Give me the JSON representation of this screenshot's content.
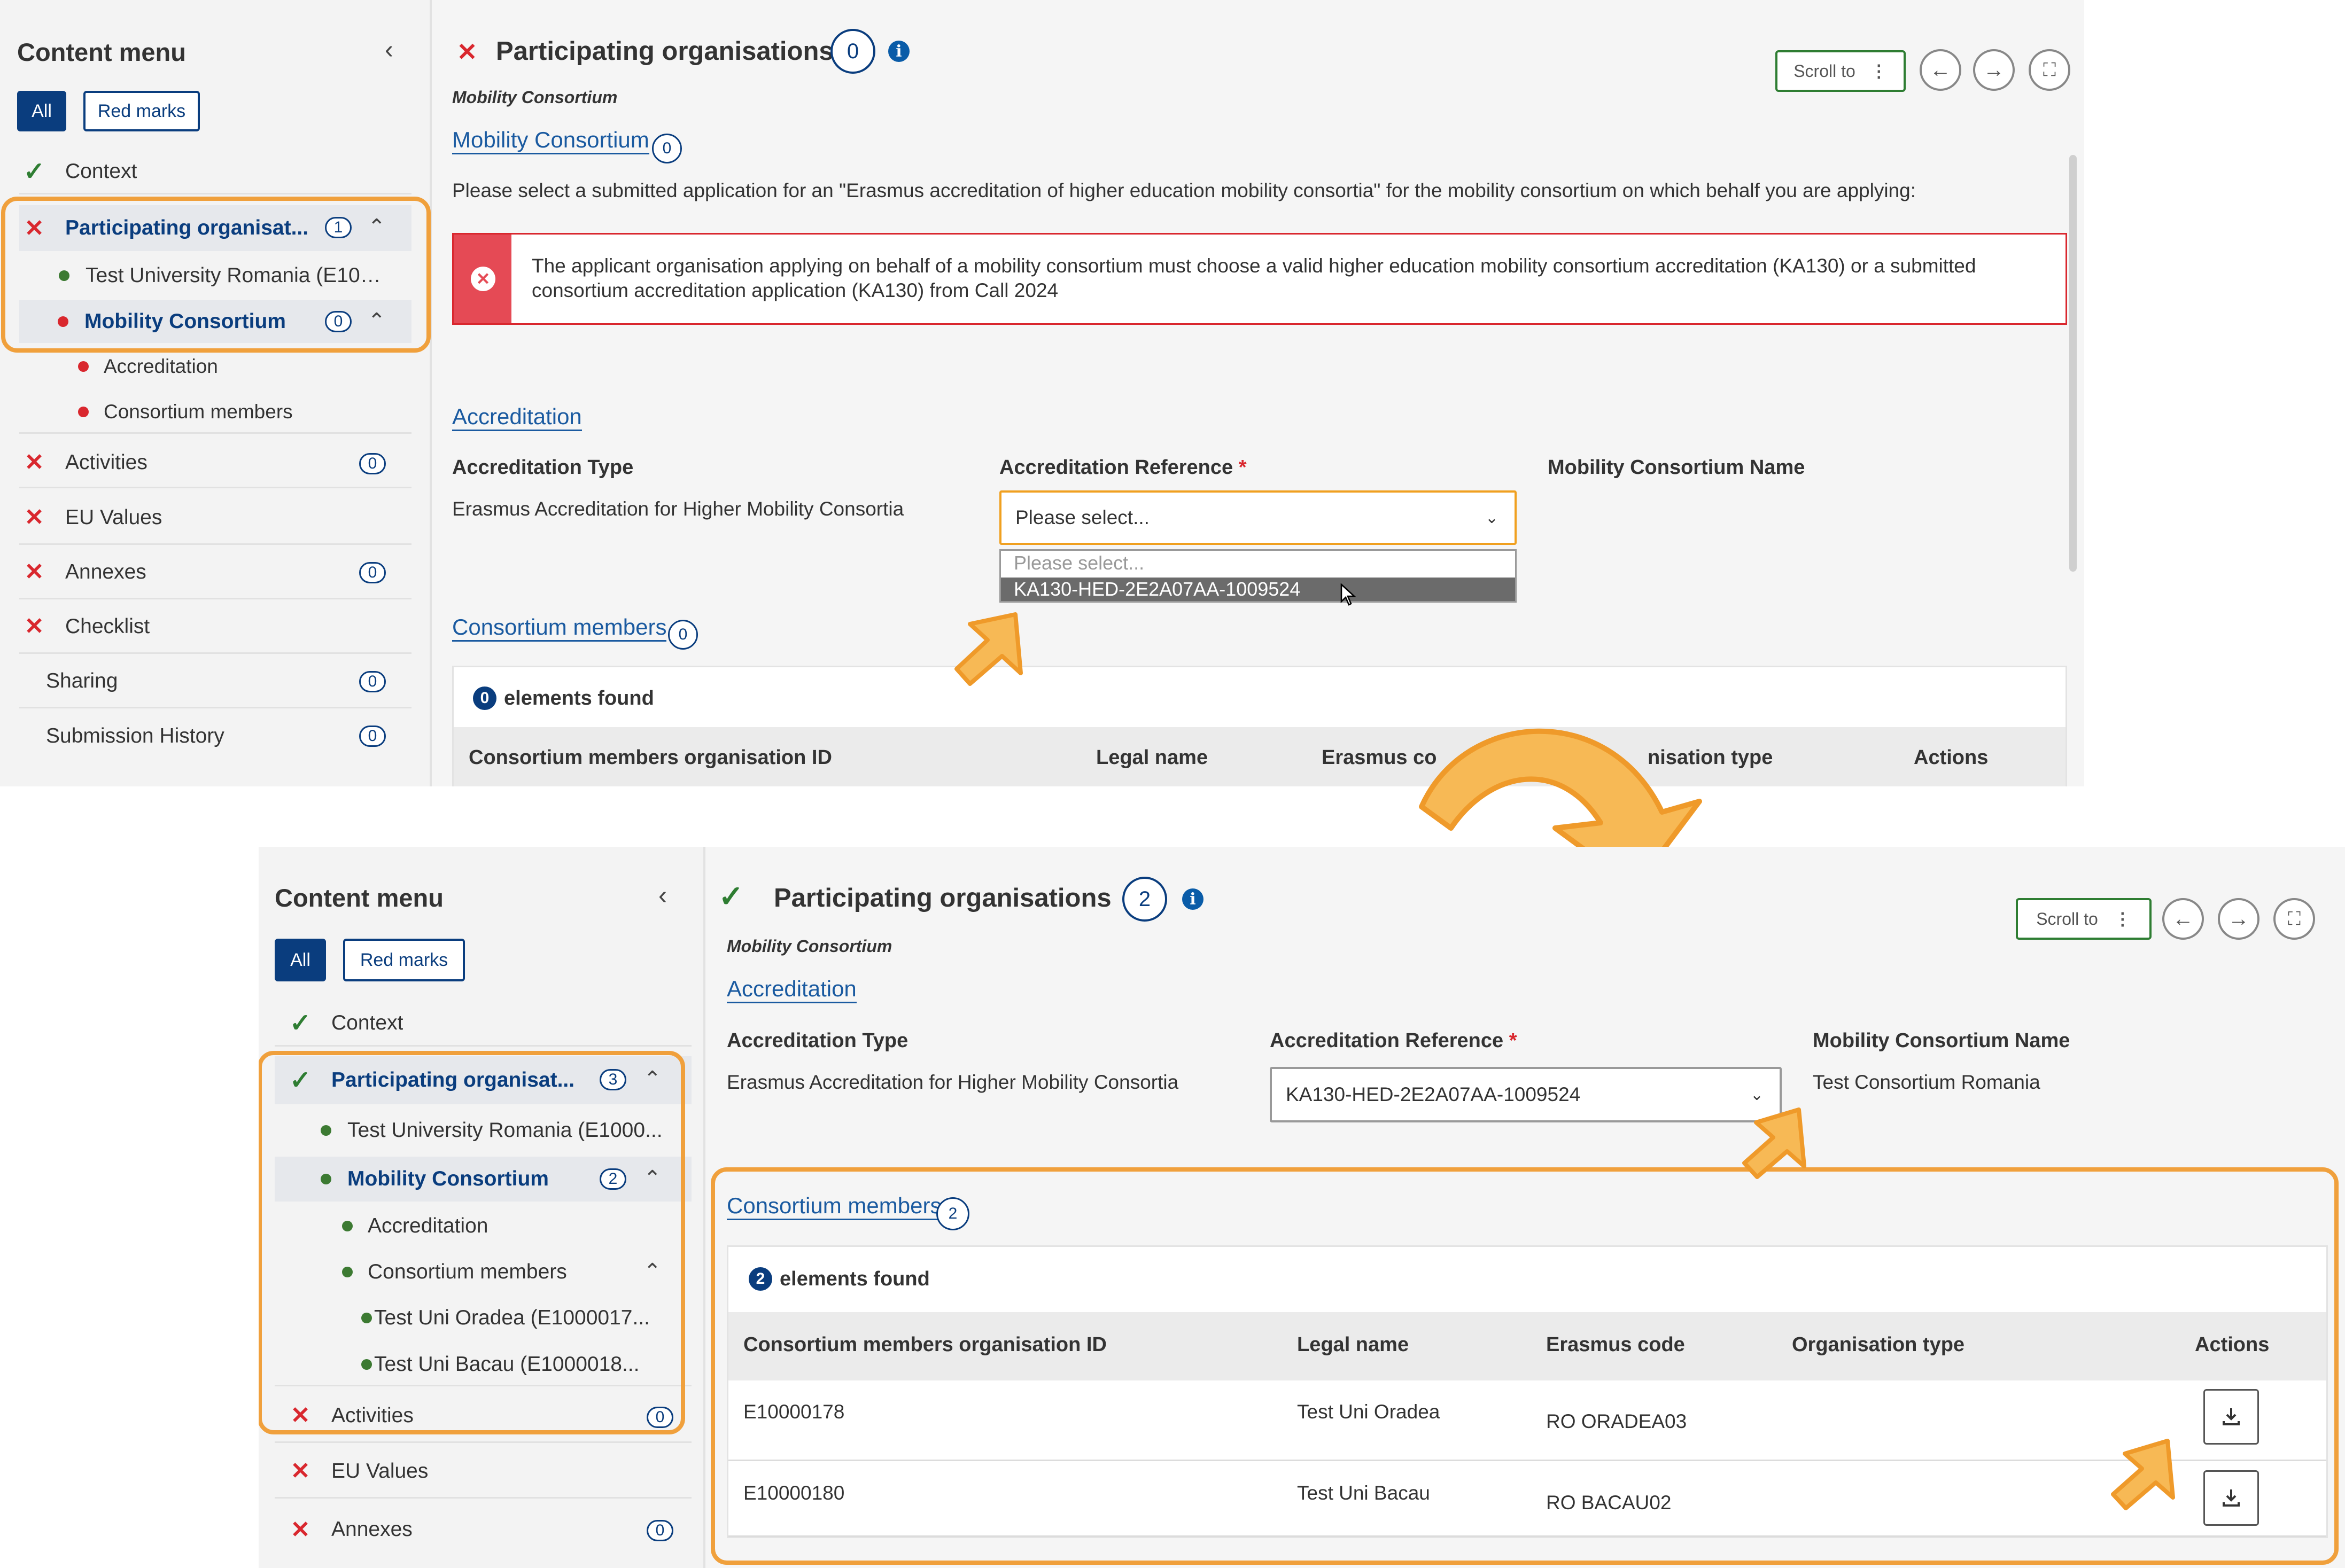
{
  "top": {
    "sidebar": {
      "title": "Content menu",
      "filter_all": "All",
      "filter_red": "Red marks",
      "items": [
        {
          "label": "Context"
        },
        {
          "label": "Participating organisat...",
          "count": "1"
        },
        {
          "label": "Test University Romania (E1000..."
        },
        {
          "label": "Mobility Consortium",
          "count": "0"
        },
        {
          "label": "Accreditation"
        },
        {
          "label": "Consortium members"
        },
        {
          "label": "Activities",
          "count": "0"
        },
        {
          "label": "EU Values"
        },
        {
          "label": "Annexes",
          "count": "0"
        },
        {
          "label": "Checklist"
        },
        {
          "label": "Sharing",
          "count": "0"
        },
        {
          "label": "Submission History",
          "count": "0"
        }
      ]
    },
    "main": {
      "title": "Participating organisations",
      "title_count": "0",
      "scroll_to": "Scroll to",
      "subtitle": "Mobility Consortium",
      "section_mobility": "Mobility Consortium",
      "section_mobility_count": "0",
      "instruction": "Please select a submitted application for an \"Erasmus accreditation of higher education mobility consortia\" for the mobility consortium on which behalf you are applying:",
      "error_message": "The applicant organisation applying on behalf of a mobility consortium must choose a valid higher education mobility consortium accreditation (KA130) or a submitted consortium accreditation application (KA130) from Call 2024",
      "section_accreditation": "Accreditation",
      "accr_type_label": "Accreditation Type",
      "accr_type_value": "Erasmus Accreditation for Higher Mobility Consortia",
      "accr_ref_label": "Accreditation Reference",
      "accr_ref_placeholder": "Please select...",
      "consortium_name_label": "Mobility Consortium Name",
      "dropdown_options": [
        "Please select...",
        "KA130-HED-2E2A07AA-1009524"
      ],
      "section_members": "Consortium members",
      "section_members_count": "0",
      "found_count": "0",
      "found_text": "elements found",
      "columns": [
        "Consortium members organisation ID",
        "Legal name",
        "Erasmus co",
        "nisation type",
        "Actions"
      ]
    }
  },
  "bottom": {
    "sidebar": {
      "title": "Content menu",
      "filter_all": "All",
      "filter_red": "Red marks",
      "items": [
        {
          "label": "Context"
        },
        {
          "label": "Participating organisat...",
          "count": "3"
        },
        {
          "label": "Test University Romania (E1000..."
        },
        {
          "label": "Mobility Consortium",
          "count": "2"
        },
        {
          "label": "Accreditation"
        },
        {
          "label": "Consortium members"
        },
        {
          "label": "Test Uni Oradea (E1000017..."
        },
        {
          "label": "Test Uni Bacau (E1000018..."
        },
        {
          "label": "Activities",
          "count": "0"
        },
        {
          "label": "EU Values"
        },
        {
          "label": "Annexes",
          "count": "0"
        }
      ]
    },
    "main": {
      "title": "Participating organisations",
      "title_count": "2",
      "scroll_to": "Scroll to",
      "subtitle": "Mobility Consortium",
      "section_accreditation": "Accreditation",
      "accr_type_label": "Accreditation Type",
      "accr_type_value": "Erasmus Accreditation for Higher Mobility Consortia",
      "accr_ref_label": "Accreditation Reference",
      "accr_ref_value": "KA130-HED-2E2A07AA-1009524",
      "consortium_name_label": "Mobility Consortium Name",
      "consortium_name_value": "Test Consortium Romania",
      "section_members": "Consortium members",
      "section_members_count": "2",
      "found_count": "2",
      "found_text": "elements found",
      "columns": [
        "Consortium members organisation ID",
        "Legal name",
        "Erasmus code",
        "Organisation type",
        "Actions"
      ],
      "rows": [
        {
          "id": "E10000178",
          "legal_name": "Test Uni Oradea",
          "erasmus_code": "RO ORADEA03",
          "org_type": ""
        },
        {
          "id": "E10000180",
          "legal_name": "Test Uni Bacau",
          "erasmus_code": "RO BACAU02",
          "org_type": ""
        }
      ]
    }
  },
  "icons": {
    "collapse": "chevron-left-icon",
    "expand": "chevron-up-icon",
    "info": "info-icon",
    "prev": "arrow-left-icon",
    "next": "arrow-right-icon",
    "fullscreen": "fullscreen-icon",
    "download": "download-icon",
    "pointer": "highlight-arrow-icon"
  },
  "colors": {
    "primary": "#0a3d7e",
    "error": "#d9272e",
    "success": "#2e7d32",
    "highlight": "#f0a03c"
  }
}
